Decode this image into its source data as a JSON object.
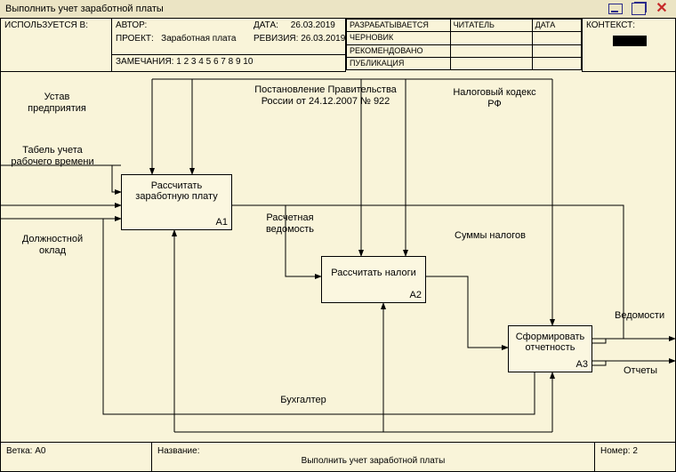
{
  "window": {
    "title": "Выполнить учет заработной платы"
  },
  "header": {
    "used_in_label": "ИСПОЛЬЗУЕТСЯ В:",
    "author_label": "АВТОР:",
    "project_label": "ПРОЕКТ:",
    "project_value": "Заработная плата",
    "date_label": "ДАТА:",
    "date_value": "26.03.2019",
    "revision_label": "РЕВИЗИЯ:",
    "revision_value": "26.03.2019",
    "notes_label": "ЗАМЕЧАНИЯ:",
    "notes_value": "1  2  3  4  5  6  7  8  9  10",
    "status": {
      "developing": "РАЗРАБАТЫВАЕТСЯ",
      "draft": "ЧЕРНОВИК",
      "recommended": "РЕКОМЕНДОВАНО",
      "publication": "ПУБЛИКАЦИЯ",
      "reader": "ЧИТАТЕЛЬ",
      "col_date": "ДАТА"
    },
    "context_label": "КОНТЕКСТ:"
  },
  "controls": {
    "c1": "Устав предприятия",
    "c2": "Постановление Правительства России от 24.12.2007 № 922",
    "c3": "Налоговый кодекс РФ"
  },
  "inputs": {
    "i1": "Табель учета рабочего времени",
    "i2": "Должностной оклад"
  },
  "outputs": {
    "o1": "Ведомости",
    "o2": "Отчеты"
  },
  "mechanism": {
    "m1": "Бухгалтер"
  },
  "flows": {
    "f1": "Расчетная ведомость",
    "f2": "Суммы налогов"
  },
  "blocks": {
    "a1": {
      "title": "Рассчитать заработную плату",
      "id": "A1"
    },
    "a2": {
      "title": "Рассчитать налоги",
      "id": "A2"
    },
    "a3": {
      "title": "Сформировать отчетность",
      "id": "A3"
    }
  },
  "footer": {
    "branch_label": "Ветка:",
    "branch_value": "A0",
    "name_label": "Название:",
    "name_value": "Выполнить учет заработной платы",
    "number_label": "Номер:",
    "number_value": "2"
  }
}
